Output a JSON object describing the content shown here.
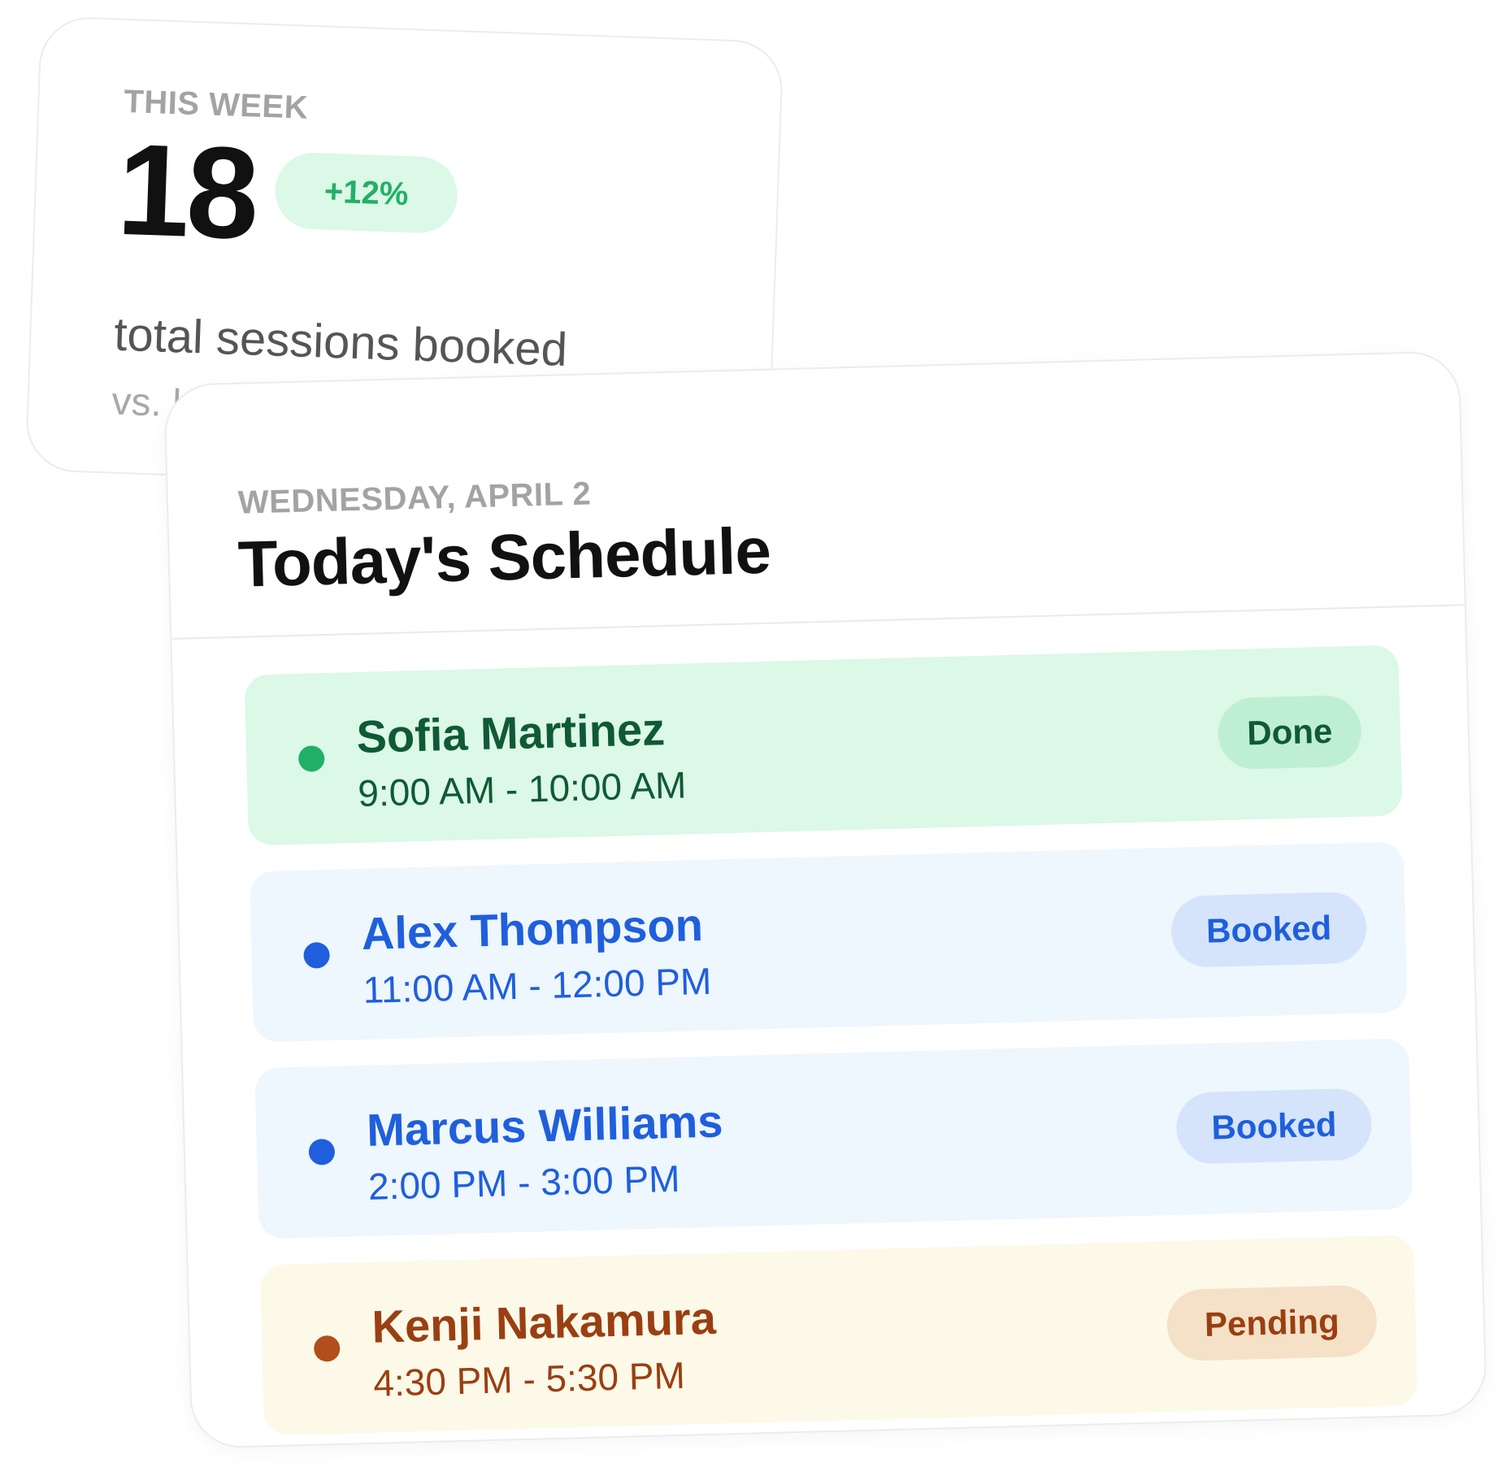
{
  "stats": {
    "eyebrow": "THIS WEEK",
    "value": "18",
    "change": "+12%",
    "label": "total sessions booked",
    "sublabel": "vs. l"
  },
  "schedule": {
    "date": "WEDNESDAY, APRIL 2",
    "title": "Today's Schedule",
    "sessions": [
      {
        "name": "Sofia Martinez",
        "time": "9:00 AM - 10:00 AM",
        "status": "Done"
      },
      {
        "name": "Alex Thompson",
        "time": "11:00 AM - 12:00 PM",
        "status": "Booked"
      },
      {
        "name": "Marcus Williams",
        "time": "2:00 PM - 3:00 PM",
        "status": "Booked"
      },
      {
        "name": "Kenji Nakamura",
        "time": "4:30 PM - 5:30 PM",
        "status": "Pending"
      }
    ]
  },
  "colors": {
    "done": "#22b068",
    "booked": "#1f5fdc",
    "pending": "#b14e1c"
  }
}
